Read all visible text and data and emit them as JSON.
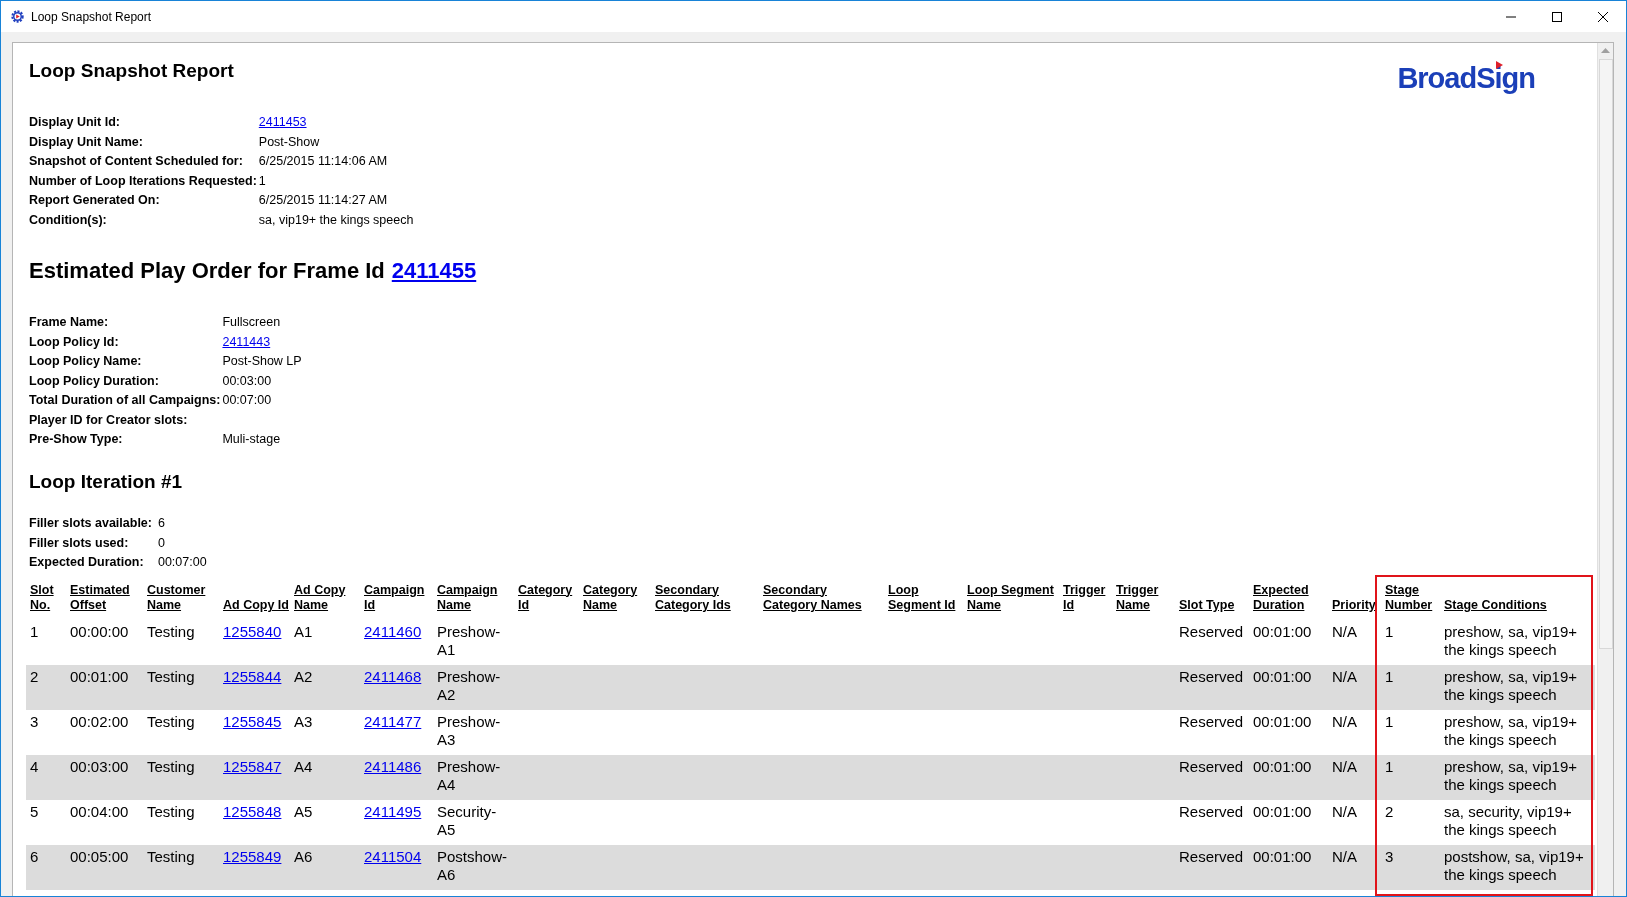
{
  "window": {
    "title": "Loop Snapshot Report"
  },
  "report": {
    "title": "Loop Snapshot Report",
    "logo": "BroadSign",
    "details": [
      {
        "label": "Display Unit Id:",
        "value": "2411453",
        "kind": "link"
      },
      {
        "label": "Display Unit Name:",
        "value": "Post-Show",
        "kind": "text"
      },
      {
        "label": "Snapshot of Content Scheduled for:",
        "value": "6/25/2015 11:14:06 AM",
        "kind": "text"
      },
      {
        "label": "Number of Loop Iterations Requested:",
        "value": "1",
        "kind": "text"
      },
      {
        "label": "Report Generated On:",
        "value": "6/25/2015 11:14:27 AM",
        "kind": "text"
      },
      {
        "label": "Condition(s):",
        "value": "sa, vip19+ the kings speech",
        "kind": "text"
      }
    ]
  },
  "frame": {
    "heading": "Estimated Play Order for Frame Id",
    "frame_id": "2411455",
    "details": [
      {
        "label": "Frame Name:",
        "value": "Fullscreen",
        "kind": "text"
      },
      {
        "label": "Loop Policy Id:",
        "value": "2411443",
        "kind": "link"
      },
      {
        "label": "Loop Policy Name:",
        "value": "Post-Show LP",
        "kind": "text"
      },
      {
        "label": "Loop Policy Duration:",
        "value": "00:03:00",
        "kind": "text"
      },
      {
        "label": "Total Duration of all Campaigns:",
        "value": "00:07:00",
        "kind": "text"
      },
      {
        "label": "Player ID for Creator slots:",
        "kind": "text"
      },
      {
        "label": "Pre-Show Type:",
        "value": "Muli-stage",
        "kind": "text"
      }
    ]
  },
  "iteration": {
    "heading": "Loop Iteration #1",
    "details": [
      {
        "label": "Filler slots available:",
        "value": "6",
        "kind": "text"
      },
      {
        "label": "Filler slots used:",
        "value": "0",
        "kind": "text"
      },
      {
        "label": "Expected Duration:",
        "value": "00:07:00",
        "kind": "text"
      }
    ]
  },
  "table": {
    "columns": [
      {
        "label": "Slot No.",
        "kind": "text"
      },
      {
        "label": "Estimated Offset",
        "kind": "text"
      },
      {
        "label": "Customer Name",
        "kind": "text"
      },
      {
        "label": "Ad Copy Id",
        "kind": "link"
      },
      {
        "label": "Ad Copy Name",
        "kind": "text"
      },
      {
        "label": "Campaign Id",
        "kind": "link"
      },
      {
        "label": "Campaign Name",
        "kind": "text"
      },
      {
        "label": "Category Id"
      },
      {
        "label": "Category Name"
      },
      {
        "label": "Secondary Category Ids"
      },
      {
        "label": "Secondary Category Names"
      },
      {
        "label": "Loop Segment Id"
      },
      {
        "label": "Loop Segment Name"
      },
      {
        "label": "Trigger Id"
      },
      {
        "label": "Trigger Name"
      },
      {
        "label": "Slot Type",
        "kind": "text"
      },
      {
        "label": "Expected Duration",
        "kind": "text"
      },
      {
        "label": "Priority",
        "kind": "text"
      },
      {
        "label": "Stage Number",
        "kind": "text"
      },
      {
        "label": "Stage Conditions",
        "kind": "text"
      }
    ],
    "rows": [
      {
        "slot_no": "1",
        "estimated_offset": "00:00:00",
        "customer_name": "Testing",
        "ad_copy_id": "1255840",
        "ad_copy_name": "A1",
        "campaign_id": "2411460",
        "campaign_name": "Preshow-A1",
        "slot_type": "Reserved",
        "expected_duration": "00:01:00",
        "priority": "N/A",
        "stage_number": "1",
        "stage_conditions": "preshow, sa, vip19+ the kings speech"
      },
      {
        "slot_no": "2",
        "estimated_offset": "00:01:00",
        "customer_name": "Testing",
        "ad_copy_id": "1255844",
        "ad_copy_name": "A2",
        "campaign_id": "2411468",
        "campaign_name": "Preshow-A2",
        "slot_type": "Reserved",
        "expected_duration": "00:01:00",
        "priority": "N/A",
        "stage_number": "1",
        "stage_conditions": "preshow, sa, vip19+ the kings speech"
      },
      {
        "slot_no": "3",
        "estimated_offset": "00:02:00",
        "customer_name": "Testing",
        "ad_copy_id": "1255845",
        "ad_copy_name": "A3",
        "campaign_id": "2411477",
        "campaign_name": "Preshow-A3",
        "slot_type": "Reserved",
        "expected_duration": "00:01:00",
        "priority": "N/A",
        "stage_number": "1",
        "stage_conditions": "preshow, sa, vip19+ the kings speech"
      },
      {
        "slot_no": "4",
        "estimated_offset": "00:03:00",
        "customer_name": "Testing",
        "ad_copy_id": "1255847",
        "ad_copy_name": "A4",
        "campaign_id": "2411486",
        "campaign_name": "Preshow-A4",
        "slot_type": "Reserved",
        "expected_duration": "00:01:00",
        "priority": "N/A",
        "stage_number": "1",
        "stage_conditions": "preshow, sa, vip19+ the kings speech"
      },
      {
        "slot_no": "5",
        "estimated_offset": "00:04:00",
        "customer_name": "Testing",
        "ad_copy_id": "1255848",
        "ad_copy_name": "A5",
        "campaign_id": "2411495",
        "campaign_name": "Security-A5",
        "slot_type": "Reserved",
        "expected_duration": "00:01:00",
        "priority": "N/A",
        "stage_number": "2",
        "stage_conditions": "sa, security, vip19+ the kings speech"
      },
      {
        "slot_no": "6",
        "estimated_offset": "00:05:00",
        "customer_name": "Testing",
        "ad_copy_id": "1255849",
        "ad_copy_name": "A6",
        "campaign_id": "2411504",
        "campaign_name": "Postshow-A6",
        "slot_type": "Reserved",
        "expected_duration": "00:01:00",
        "priority": "N/A",
        "stage_number": "3",
        "stage_conditions": "postshow, sa, vip19+ the kings speech"
      }
    ]
  }
}
